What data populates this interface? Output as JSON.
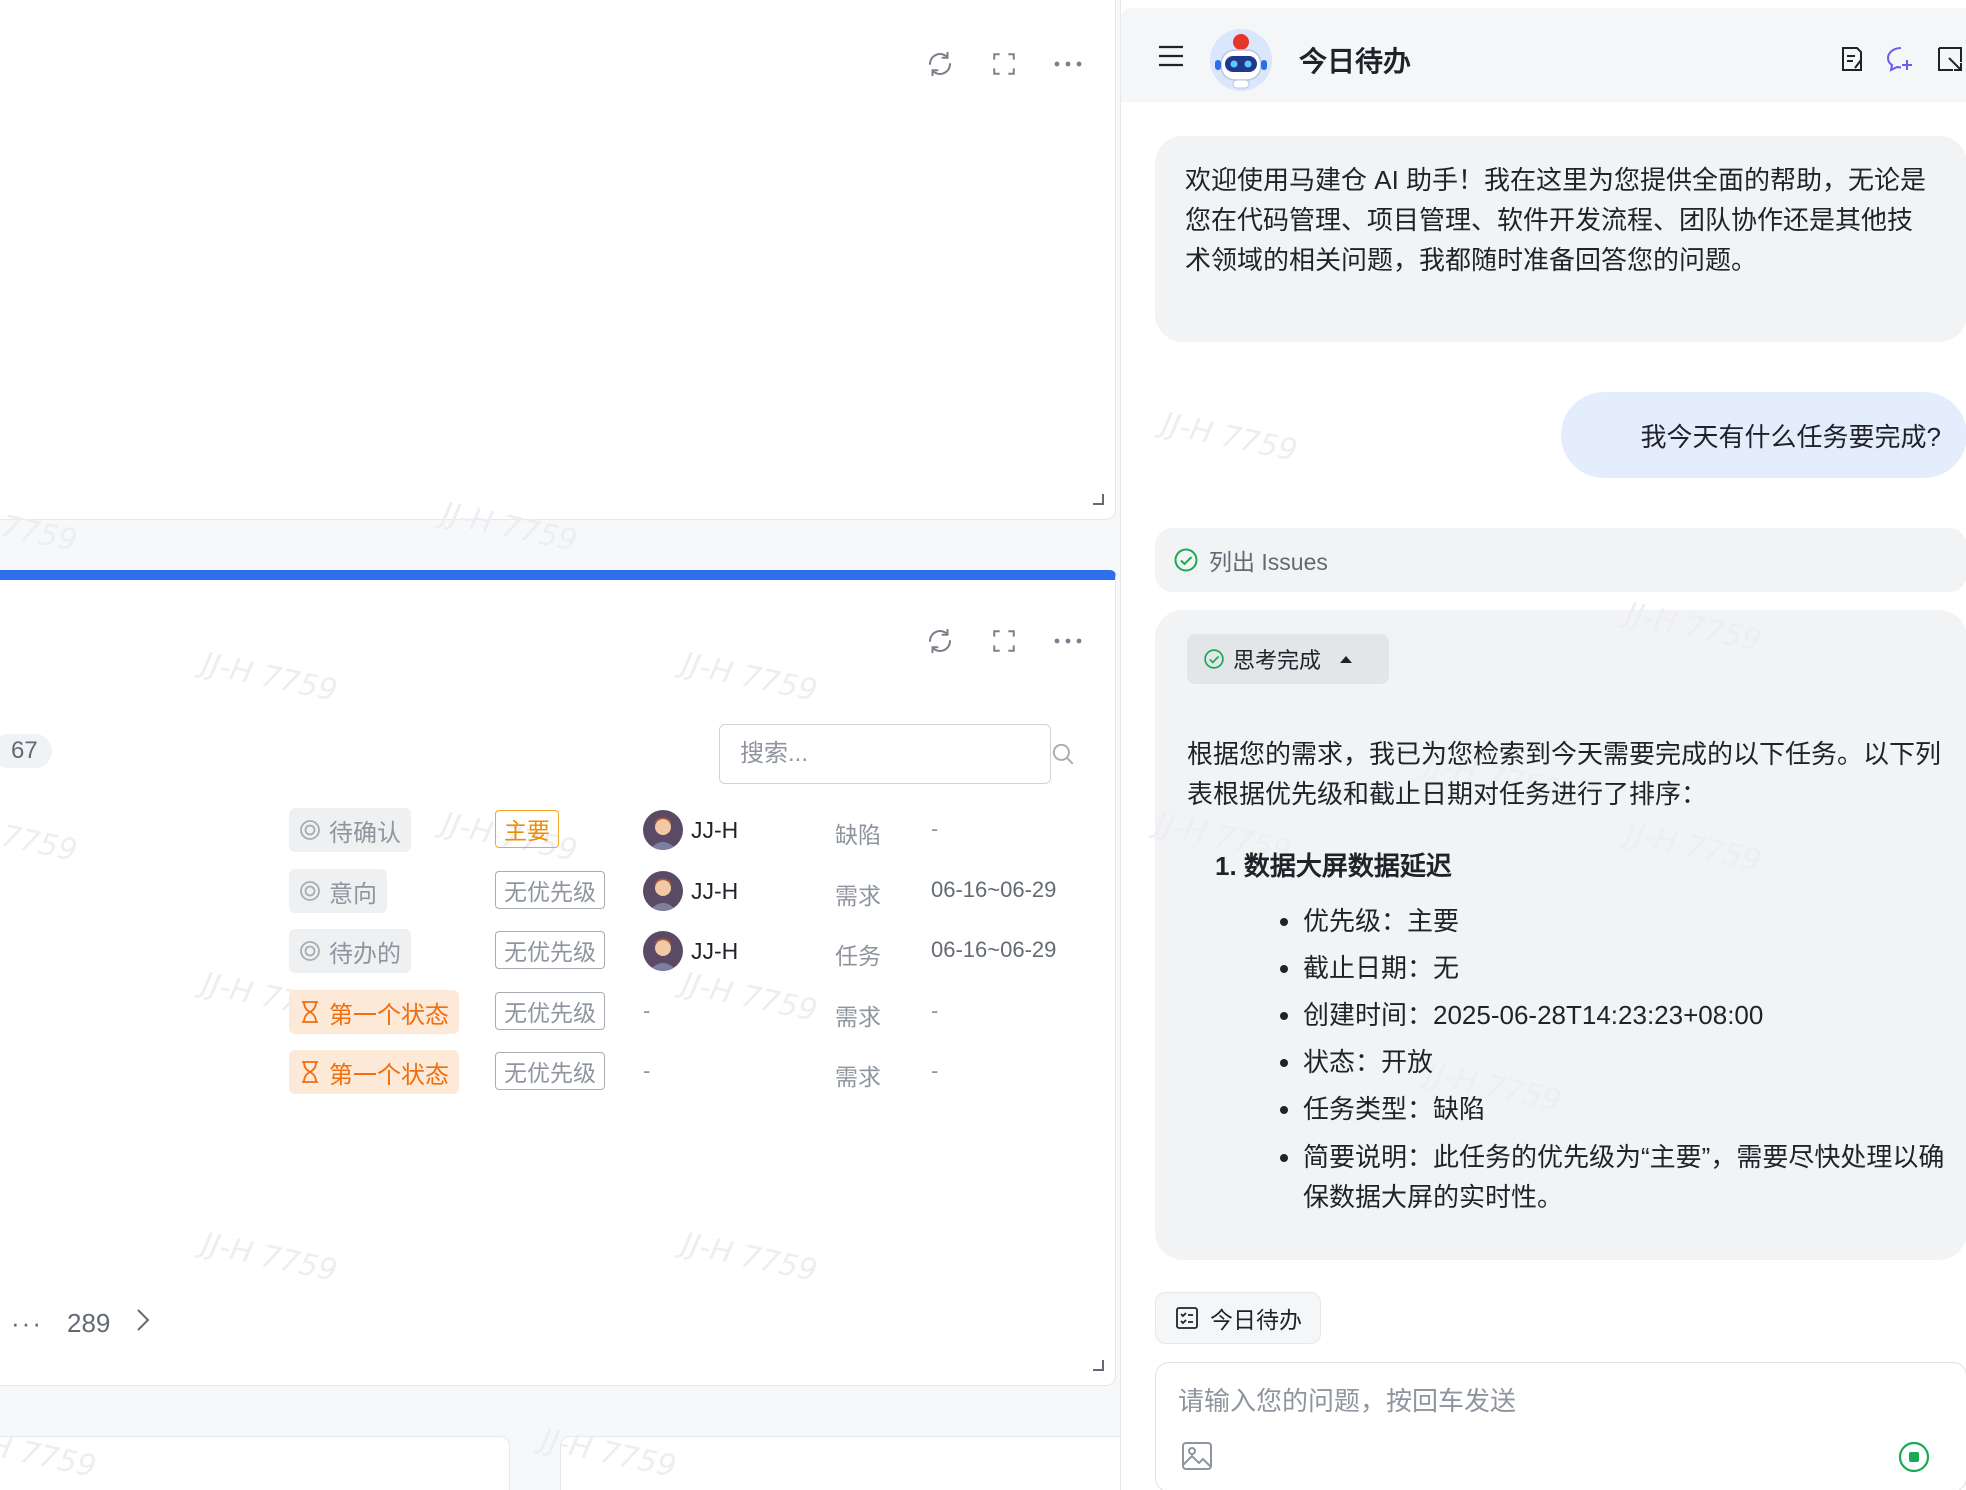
{
  "watermark": "JJ-H 7759",
  "issues_panel": {
    "count_fragment": "67",
    "search_placeholder": "搜索...",
    "rows": [
      {
        "status": "待确认",
        "status_style": "gray",
        "priority": "主要",
        "priority_style": "main",
        "assignee": "JJ-H",
        "type": "缺陷",
        "date": "-"
      },
      {
        "status": "意向",
        "status_style": "gray",
        "priority": "无优先级",
        "priority_style": "none",
        "assignee": "JJ-H",
        "type": "需求",
        "date": "06-16~06-29"
      },
      {
        "status": "待办的",
        "status_style": "gray",
        "priority": "无优先级",
        "priority_style": "none",
        "assignee": "JJ-H",
        "type": "任务",
        "date": "06-16~06-29"
      },
      {
        "status": "第一个状态",
        "status_style": "orange",
        "priority": "无优先级",
        "priority_style": "none",
        "assignee": "-",
        "type": "需求",
        "date": "-"
      },
      {
        "status": "第一个状态",
        "status_style": "orange",
        "priority": "无优先级",
        "priority_style": "none",
        "assignee": "-",
        "type": "需求",
        "date": "-"
      }
    ],
    "pagination": {
      "ellipsis": "···",
      "last_page": "289"
    }
  },
  "chat": {
    "title": "今日待办",
    "welcome": "欢迎使用马建仓 AI 助手！我在这里为您提供全面的帮助，无论是您在代码管理、项目管理、软件开发流程、团队协作还是其他技术领域的相关问题，我都随时准备回答您的问题。",
    "user_question": "我今天有什么任务要完成?",
    "tool_call_label": "列出 Issues",
    "thinking_label": "思考完成",
    "answer_intro": "根据您的需求，我已为您检索到今天需要完成的以下任务。以下列表根据优先级和截止日期对任务进行了排序：",
    "task_heading": "1. 数据大屏数据延迟",
    "task_details": [
      "优先级：主要",
      "截止日期：无",
      "创建时间：2025-06-28T14:23:23+08:00",
      "状态：开放",
      "任务类型：缺陷",
      "简要说明：此任务的优先级为“主要”，需要尽快处理以确保数据大屏的实时性。"
    ],
    "quick_chip": "今日待办",
    "input_placeholder": "请输入您的问题，按回车发送"
  },
  "colors": {
    "accent_blue": "#2f6fed",
    "status_orange": "#f06e10",
    "priority_main": "#f08c00",
    "success_green": "#1aaa55",
    "user_bubble": "#e3edfc"
  },
  "icons": [
    "refresh-icon",
    "fullscreen-icon",
    "more-icon",
    "search-icon",
    "status-circle-icon",
    "hourglass-icon",
    "chevron-right-icon",
    "menu-icon",
    "bot-avatar",
    "new-note-icon",
    "new-chat-icon",
    "popout-icon",
    "check-circle-icon",
    "caret-up-icon",
    "checklist-icon",
    "image-icon",
    "stop-icon"
  ]
}
